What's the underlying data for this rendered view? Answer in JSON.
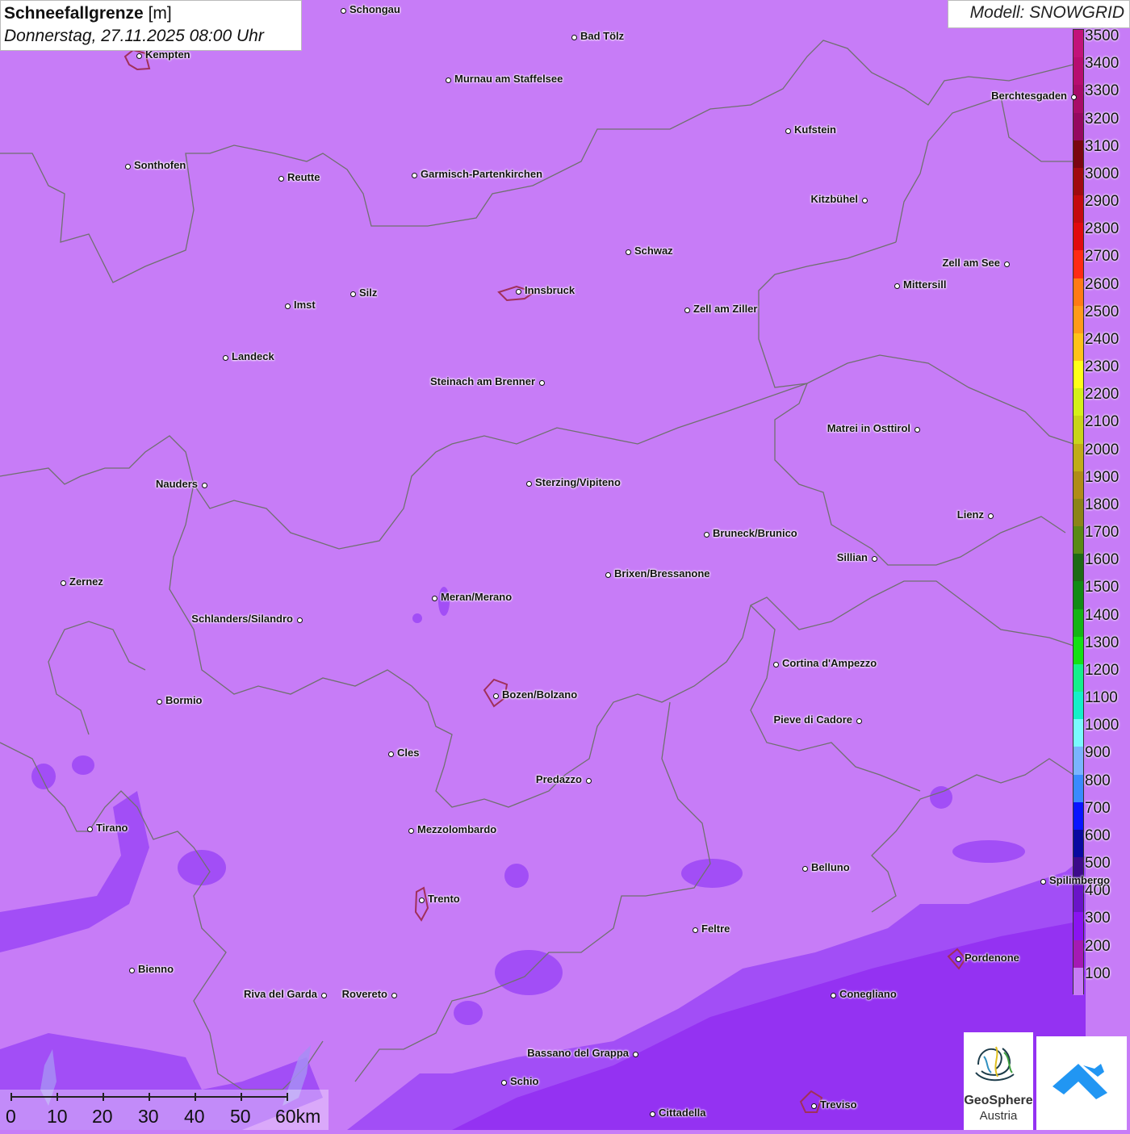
{
  "title": {
    "parameter": "Schneefallgrenze",
    "unit": "[m]",
    "datetime": "Donnerstag, 27.11.2025 08:00 Uhr"
  },
  "model_label": "Modell: SNOWGRID",
  "colors": {
    "background": "#c77cf7",
    "purple_low": "#a44af5",
    "purple_lower": "#8a2be2",
    "border_line": "#707070",
    "city_outline": "#a0305a"
  },
  "legend": [
    {
      "value": "3500",
      "color": "#c2127a"
    },
    {
      "value": "3400",
      "color": "#b70d70"
    },
    {
      "value": "3300",
      "color": "#a80b68"
    },
    {
      "value": "3200",
      "color": "#950860"
    },
    {
      "value": "3100",
      "color": "#7a0610"
    },
    {
      "value": "3000",
      "color": "#a00a10"
    },
    {
      "value": "2900",
      "color": "#c40a10"
    },
    {
      "value": "2800",
      "color": "#e00a10"
    },
    {
      "value": "2700",
      "color": "#ff2a14"
    },
    {
      "value": "2600",
      "color": "#ff7a14"
    },
    {
      "value": "2500",
      "color": "#ff9a1a"
    },
    {
      "value": "2400",
      "color": "#ffc21a"
    },
    {
      "value": "2300",
      "color": "#ffff1a"
    },
    {
      "value": "2200",
      "color": "#d4f01a"
    },
    {
      "value": "2100",
      "color": "#c8d41a"
    },
    {
      "value": "2000",
      "color": "#c0ac18"
    },
    {
      "value": "1900",
      "color": "#b08c18"
    },
    {
      "value": "1800",
      "color": "#8c8418"
    },
    {
      "value": "1700",
      "color": "#5a8a14"
    },
    {
      "value": "1600",
      "color": "#1e6a14"
    },
    {
      "value": "1500",
      "color": "#128a14"
    },
    {
      "value": "1400",
      "color": "#14b414"
    },
    {
      "value": "1300",
      "color": "#14e014"
    },
    {
      "value": "1200",
      "color": "#14f08c"
    },
    {
      "value": "1100",
      "color": "#14f0c8"
    },
    {
      "value": "1000",
      "color": "#7afaff"
    },
    {
      "value": "900",
      "color": "#7ab4ff"
    },
    {
      "value": "800",
      "color": "#3a8aff"
    },
    {
      "value": "700",
      "color": "#0a14ff"
    },
    {
      "value": "600",
      "color": "#0a0aa0"
    },
    {
      "value": "500",
      "color": "#3c0a8a"
    },
    {
      "value": "400",
      "color": "#6a14c8"
    },
    {
      "value": "300",
      "color": "#8a14f0"
    },
    {
      "value": "200",
      "color": "#a41ab4"
    },
    {
      "value": "100",
      "color": "#c87cf5"
    }
  ],
  "scale_bar": [
    "0",
    "10",
    "20",
    "30",
    "40",
    "50",
    "60km"
  ],
  "logos": {
    "geosphere_line1": "GeoSphere",
    "geosphere_line2": "Austria"
  },
  "cities": [
    {
      "name": "Schongau",
      "side": "right"
    },
    {
      "name": "Bad Tölz",
      "side": "right"
    },
    {
      "name": "Kempten",
      "side": "right"
    },
    {
      "name": "Murnau am Staffelsee",
      "side": "right"
    },
    {
      "name": "Berchtesgaden",
      "side": "left"
    },
    {
      "name": "Kufstein",
      "side": "right"
    },
    {
      "name": "Sonthofen",
      "side": "right"
    },
    {
      "name": "Reutte",
      "side": "right"
    },
    {
      "name": "Garmisch-Partenkirchen",
      "side": "right"
    },
    {
      "name": "Kitzbühel",
      "side": "left"
    },
    {
      "name": "Schwaz",
      "side": "right"
    },
    {
      "name": "Zell am See",
      "side": "left"
    },
    {
      "name": "Mittersill",
      "side": "right"
    },
    {
      "name": "Innsbruck",
      "side": "right"
    },
    {
      "name": "Silz",
      "side": "right"
    },
    {
      "name": "Imst",
      "side": "right"
    },
    {
      "name": "Zell am Ziller",
      "side": "right"
    },
    {
      "name": "Landeck",
      "side": "right"
    },
    {
      "name": "Steinach am Brenner",
      "side": "left"
    },
    {
      "name": "Matrei in Osttirol",
      "side": "left"
    },
    {
      "name": "Nauders",
      "side": "left"
    },
    {
      "name": "Sterzing/Vipiteno",
      "side": "right"
    },
    {
      "name": "Lienz",
      "side": "left"
    },
    {
      "name": "Bruneck/Brunico",
      "side": "right"
    },
    {
      "name": "Sillian",
      "side": "left"
    },
    {
      "name": "Zernez",
      "side": "right"
    },
    {
      "name": "Brixen/Bressanone",
      "side": "right"
    },
    {
      "name": "Meran/Merano",
      "side": "right"
    },
    {
      "name": "Schlanders/Silandro",
      "side": "left"
    },
    {
      "name": "Cortina d'Ampezzo",
      "side": "right"
    },
    {
      "name": "Bormio",
      "side": "right"
    },
    {
      "name": "Bozen/Bolzano",
      "side": "right"
    },
    {
      "name": "Pieve di Cadore",
      "side": "left"
    },
    {
      "name": "Cles",
      "side": "right"
    },
    {
      "name": "Predazzo",
      "side": "left"
    },
    {
      "name": "Tirano",
      "side": "right"
    },
    {
      "name": "Mezzolombardo",
      "side": "right"
    },
    {
      "name": "Belluno",
      "side": "right"
    },
    {
      "name": "Spilimbergo",
      "side": "right"
    },
    {
      "name": "Trento",
      "side": "right"
    },
    {
      "name": "Feltre",
      "side": "right"
    },
    {
      "name": "Pordenone",
      "side": "right"
    },
    {
      "name": "Bienno",
      "side": "right"
    },
    {
      "name": "Riva del Garda",
      "side": "left"
    },
    {
      "name": "Rovereto",
      "side": "left"
    },
    {
      "name": "Conegliano",
      "side": "right"
    },
    {
      "name": "Bassano del Grappa",
      "side": "left"
    },
    {
      "name": "Schio",
      "side": "right"
    },
    {
      "name": "Treviso",
      "side": "right"
    },
    {
      "name": "Cittadella",
      "side": "right"
    }
  ]
}
